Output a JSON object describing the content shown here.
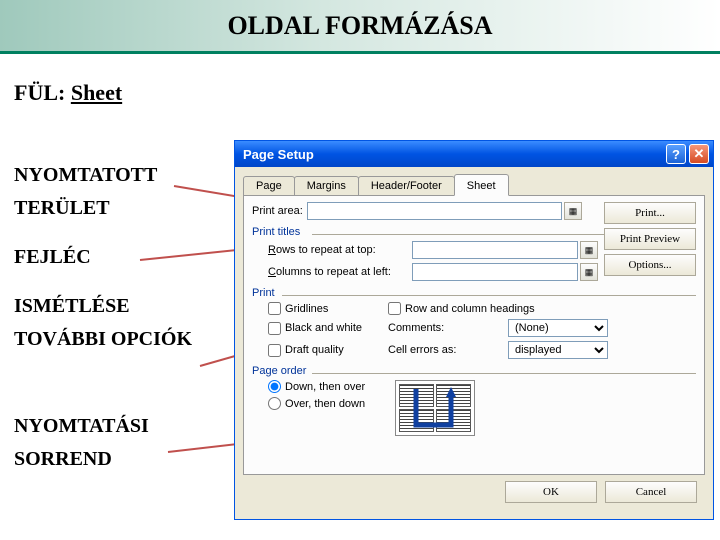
{
  "slide": {
    "title": "OLDAL FORMÁZÁSA",
    "ful_prefix": "FÜL: ",
    "ful_sheet": "Sheet",
    "labels": {
      "nyomtatott": "NYOMTATOTT",
      "terulet": "TERÜLET",
      "fejlec": "FEJLÉC",
      "ismetlese": "ISMÉTLÉSE",
      "tovabb": "TOVÁBBI OPCIÓK",
      "nyomtatasi": "NYOMTATÁSI",
      "sorrend": "SORREND"
    }
  },
  "dialog": {
    "title": "Page Setup",
    "tabs": {
      "page": "Page",
      "margins": "Margins",
      "headerfooter": "Header/Footer",
      "sheet": "Sheet"
    },
    "print_area_label": "Print area:",
    "print_titles": "Print titles",
    "rows_repeat": "Rows to repeat at top:",
    "cols_repeat": "Columns to repeat at left:",
    "print_section": "Print",
    "gridlines": "Gridlines",
    "bw": "Black and white",
    "draft": "Draft quality",
    "rowcol": "Row and column headings",
    "comments_label": "Comments:",
    "comments_value": "(None)",
    "errors_label": "Cell errors as:",
    "errors_value": "displayed",
    "page_order": "Page order",
    "down_over": "Down, then over",
    "over_down": "Over, then down",
    "buttons": {
      "print": "Print...",
      "preview": "Print Preview",
      "options": "Options...",
      "ok": "OK",
      "cancel": "Cancel"
    }
  }
}
